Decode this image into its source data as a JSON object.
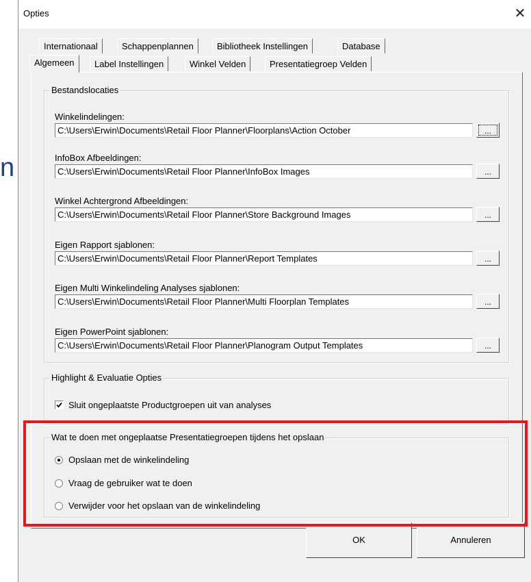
{
  "background_text": "n",
  "window": {
    "title": "Opties",
    "close_symbol": "✕"
  },
  "tabs": {
    "row1": [
      "Internationaal",
      "Schappenplannen",
      "Bibliotheek Instellingen",
      "Database"
    ],
    "row2": [
      "Algemeen",
      "Label Instellingen",
      "Winkel Velden",
      "Presentatiegroep Velden"
    ],
    "active": "Algemeen"
  },
  "file_locations": {
    "title": "Bestandslocaties",
    "browse_label": "...",
    "fields": [
      {
        "label": "Winkelindelingen:",
        "value": "C:\\Users\\Erwin\\Documents\\Retail Floor Planner\\Floorplans\\Action October"
      },
      {
        "label": "InfoBox Afbeeldingen:",
        "value": "C:\\Users\\Erwin\\Documents\\Retail Floor Planner\\InfoBox Images"
      },
      {
        "label": "Winkel Achtergrond Afbeeldingen:",
        "value": "C:\\Users\\Erwin\\Documents\\Retail Floor Planner\\Store Background Images"
      },
      {
        "label": "Eigen Rapport sjablonen:",
        "value": "C:\\Users\\Erwin\\Documents\\Retail Floor Planner\\Report Templates"
      },
      {
        "label": "Eigen Multi Winkelindeling Analyses sjablonen:",
        "value": "C:\\Users\\Erwin\\Documents\\Retail Floor Planner\\Multi Floorplan Templates"
      },
      {
        "label": "Eigen PowerPoint sjablonen:",
        "value": "C:\\Users\\Erwin\\Documents\\Retail Floor Planner\\Planogram Output Templates"
      }
    ]
  },
  "highlight_options": {
    "title": "Highlight & Evaluatie Opties",
    "checkbox_label": "Sluit ongeplaatste Productgroepen uit van analyses",
    "checked": true
  },
  "unplaced_groups": {
    "title": "Wat te doen met ongeplaatse Presentatiegroepen tijdens het opslaan",
    "options": [
      "Opslaan met de winkelindeling",
      "Vraag de gebruiker wat te doen",
      "Verwijder voor het opslaan van de winkelindeling"
    ],
    "selected_index": 0
  },
  "highlight_color": "#e8161d",
  "buttons": {
    "ok": "OK",
    "cancel": "Annuleren"
  }
}
